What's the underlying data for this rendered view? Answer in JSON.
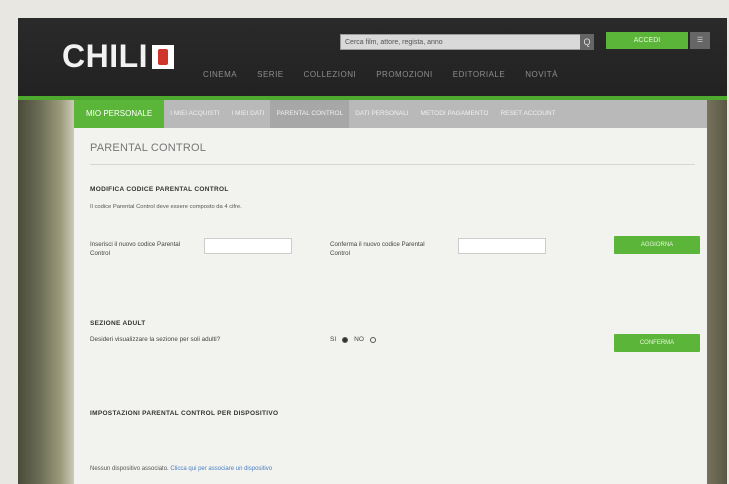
{
  "header": {
    "logo_text": "CHILI",
    "search_placeholder": "Cerca film, attore, regista, anno",
    "search_button": "Q",
    "login_label": "ACCEDI",
    "user_label": "☰",
    "nav": [
      "CINEMA",
      "SERIE",
      "COLLEZIONI",
      "PROMOZIONI",
      "EDITORIALE",
      "NOVITÀ"
    ]
  },
  "tabs": [
    {
      "label": "MIO PERSONALE",
      "state": "active"
    },
    {
      "label": "I MIEI ACQUISTI",
      "state": ""
    },
    {
      "label": "I MIEI DATI",
      "state": ""
    },
    {
      "label": "PARENTAL CONTROL",
      "state": "sel"
    },
    {
      "label": "DATI PERSONALI",
      "state": ""
    },
    {
      "label": "METODI PAGAMENTO",
      "state": ""
    },
    {
      "label": "RESET ACCOUNT",
      "state": ""
    }
  ],
  "page": {
    "title": "PARENTAL CONTROL",
    "section1": {
      "heading": "MODIFICA CODICE PARENTAL CONTROL",
      "note": "Il codice Parental Control deve essere composto da 4 cifre.",
      "field1_label": "Inserisci il nuovo codice Parental Control",
      "field2_label": "Conferma il nuovo codice Parental Control",
      "button": "AGGIORNA"
    },
    "section2": {
      "heading": "SEZIONE ADULT",
      "question": "Desideri visualizzare la sezione per soli adulti?",
      "yes": "SI",
      "no": "NO",
      "button": "CONFERMA"
    },
    "section3": {
      "heading": "IMPOSTAZIONI PARENTAL CONTROL PER DISPOSITIVO",
      "footer_text": "Nessun dispositivo associato.",
      "footer_link": "Clicca qui per associare un dispositivo"
    }
  },
  "colors": {
    "accent": "#5bb538",
    "dark": "#2b2b2b"
  }
}
